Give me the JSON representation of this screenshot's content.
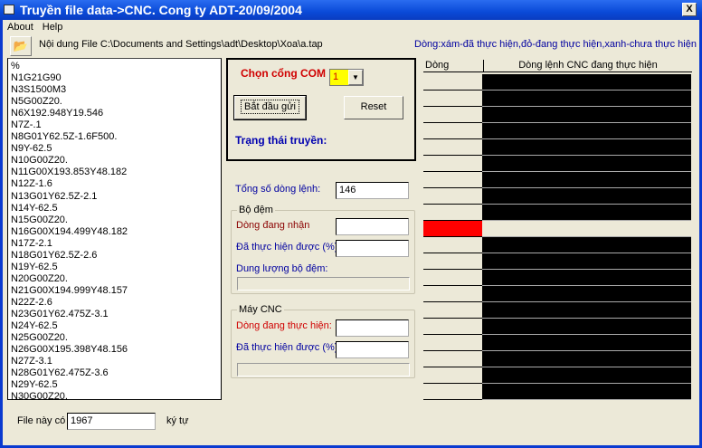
{
  "window": {
    "title": "Truyền file data->CNC. Cong ty ADT-20/09/2004",
    "close": "X"
  },
  "menu": [
    "About",
    "Help"
  ],
  "file_label": "Nội dung File C:\\Documents and Settings\\adt\\Desktop\\Xoa\\a.tap",
  "legend": "Dòng:xám-đã thực hiện,đỏ-đang thực hiện,xanh-chưa thực hiện",
  "code_lines": [
    "%",
    "N1G21G90",
    "N3S1500M3",
    "N5G00Z20.",
    "N6X192.948Y19.546",
    "N7Z-.1",
    "N8G01Y62.5Z-1.6F500.",
    "N9Y-62.5",
    "N10G00Z20.",
    "N11G00X193.853Y48.182",
    "N12Z-1.6",
    "N13G01Y62.5Z-2.1",
    "N14Y-62.5",
    "N15G00Z20.",
    "N16G00X194.499Y48.182",
    "N17Z-2.1",
    "N18G01Y62.5Z-2.6",
    "N19Y-62.5",
    "N20G00Z20.",
    "N21G00X194.999Y48.157",
    "N22Z-2.6",
    "N23G01Y62.475Z-3.1",
    "N24Y-62.5",
    "N25G00Z20.",
    "N26G00X195.398Y48.156",
    "N27Z-3.1",
    "N28G01Y62.475Z-3.6",
    "N29Y-62.5",
    "N30G00Z20."
  ],
  "com": {
    "label": "Chọn cổng COM",
    "value": "1",
    "start": "Bắt đầu gửi",
    "reset": "Reset",
    "status_label": "Trạng thái truyền:"
  },
  "total": {
    "label": "Tổng số dòng lệnh:",
    "value": "146"
  },
  "buffer": {
    "title": "Bộ đệm",
    "receiving_label": "Dòng đang nhận",
    "receiving_value": "",
    "done_label": "Đã thực hiện được (%)",
    "done_value": "",
    "capacity_label": "Dung lượng bộ đệm:",
    "capacity_progress": 0
  },
  "cnc": {
    "title": "Máy CNC",
    "executing_label": "Dòng đang thực hiện:",
    "executing_value": "",
    "done_label": "Đã thực hiện được (%)",
    "done_value": "",
    "progress": 0
  },
  "grid": {
    "col1": "Dòng",
    "col2": "Dòng lệnh CNC đang thực hiện",
    "rows": 20,
    "current_row": 9,
    "colors": {
      "current": "#ff0000",
      "pending": "#000000"
    }
  },
  "file_count": {
    "label": "File này có",
    "value": "1967",
    "unit": "ký tự"
  }
}
